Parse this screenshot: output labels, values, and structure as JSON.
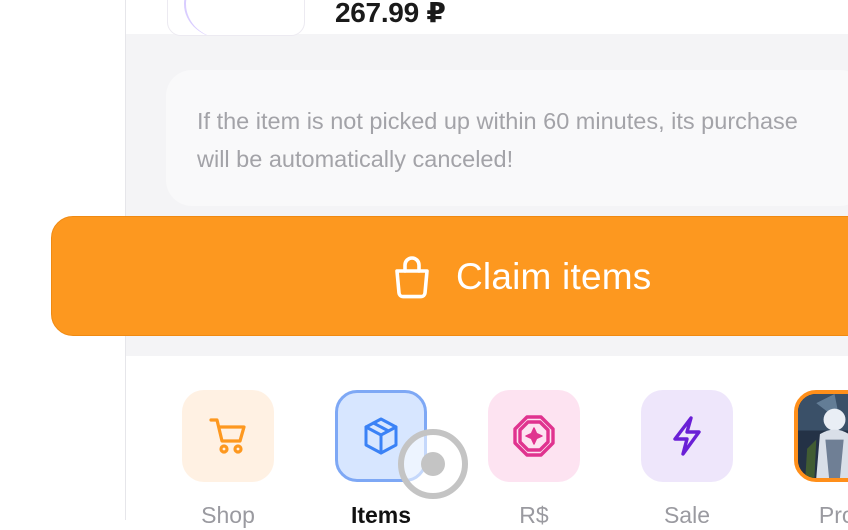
{
  "order": {
    "price": "267.99 ₽"
  },
  "notice": {
    "text": "If the item is not picked up within 60 minutes, its purchase will be automatically canceled!"
  },
  "claim_button": {
    "label": "Claim items",
    "icon": "shopping-bag-icon"
  },
  "bottom_nav": {
    "items": [
      {
        "label": "Shop",
        "icon": "cart-icon",
        "active": false
      },
      {
        "label": "Items",
        "icon": "box-icon",
        "active": true
      },
      {
        "label": "R$",
        "icon": "robux-icon",
        "active": false
      },
      {
        "label": "Sale",
        "icon": "lightning-icon",
        "active": false
      },
      {
        "label": "Prof",
        "icon": "avatar",
        "active": false
      }
    ]
  },
  "colors": {
    "accent": "#fd981f",
    "items_blue": "#3b82f6",
    "robux_pink": "#e0338f",
    "sale_purple": "#6a1fd6"
  }
}
